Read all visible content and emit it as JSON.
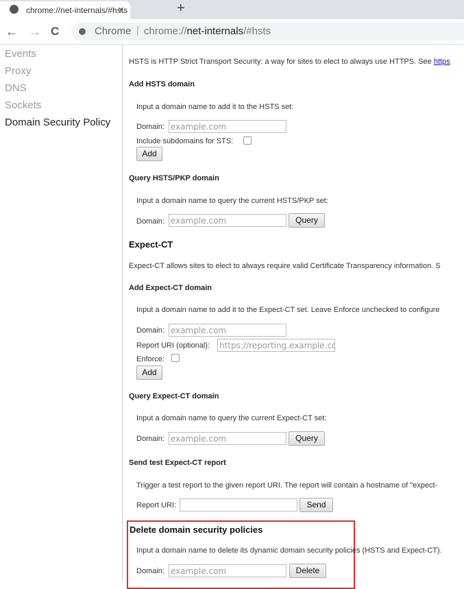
{
  "tab": {
    "title": "chrome://net-internals/#hsts",
    "close": "✕",
    "new_tab": "+"
  },
  "toolbar": {
    "back": "←",
    "forward": "→",
    "reload": "C",
    "site_label": "Chrome",
    "separator": "|",
    "url_prefix": "chrome://",
    "url_host": "net-internals",
    "url_path": "/#hsts"
  },
  "sidebar": {
    "items": [
      {
        "label": "Events"
      },
      {
        "label": "Proxy"
      },
      {
        "label": "DNS"
      },
      {
        "label": "Sockets"
      },
      {
        "label": "Domain Security Policy"
      }
    ]
  },
  "main": {
    "intro": "HSTS is HTTP Strict Transport Security: a way for sites to elect to always use HTTPS. See ",
    "intro_link": "https",
    "add_hsts": {
      "title": "Add HSTS domain",
      "desc": "Input a domain name to add it to the HSTS set:",
      "domain_label": "Domain:",
      "placeholder": "example.com",
      "subdomains_label": "Include subdomains for STS:",
      "button": "Add"
    },
    "query_hsts": {
      "title": "Query HSTS/PKP domain",
      "desc": "Input a domain name to query the current HSTS/PKP set:",
      "domain_label": "Domain:",
      "placeholder": "example.com",
      "button": "Query"
    },
    "expect_ct": {
      "title": "Expect-CT",
      "desc": "Expect-CT allows sites to elect to always require valid Certificate Transparency information. S"
    },
    "add_ct": {
      "title": "Add Expect-CT domain",
      "desc": "Input a domain name to add it to the Expect-CT set. Leave Enforce unchecked to configure",
      "domain_label": "Domain:",
      "placeholder": "example.com",
      "report_label": "Report URI (optional):",
      "report_placeholder": "https://reporting.example.cor",
      "enforce_label": "Enforce:",
      "button": "Add"
    },
    "query_ct": {
      "title": "Query Expect-CT domain",
      "desc": "Input a domain name to query the current Expect-CT set:",
      "domain_label": "Domain:",
      "placeholder": "example.com",
      "button": "Query"
    },
    "send_ct": {
      "title": "Send test Expect-CT report",
      "desc": "Trigger a test report to the given report URI. The report will contain a hostname of \"expect-",
      "report_label": "Report URI:",
      "value": "",
      "button": "Send"
    },
    "delete": {
      "title": "Delete domain security policies",
      "desc": "Input a domain name to delete its dynamic domain security policies (HSTS and Expect-CT).",
      "domain_label": "Domain:",
      "placeholder": "example.com",
      "button": "Delete"
    }
  },
  "colors": {
    "highlight": "#d9302a",
    "link": "#1a0dab"
  }
}
